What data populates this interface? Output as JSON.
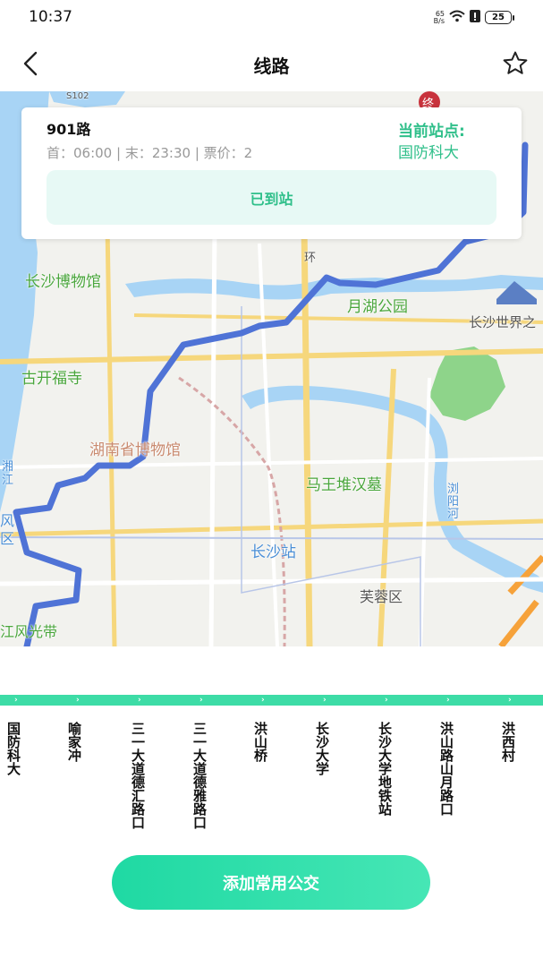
{
  "status_bar": {
    "time": "10:37",
    "net_speed_value": "65",
    "net_speed_unit": "B/s",
    "battery": "25"
  },
  "nav": {
    "title": "线路"
  },
  "map": {
    "labels": {
      "museum": "长沙博物馆",
      "yuehu_park": "月湖公园",
      "world": "长沙世界之",
      "gukai_temple": "古开福寺",
      "hunan_museum": "湖南省博物馆",
      "mawangdui": "马王堆汉墓",
      "changsha_station": "长沙站",
      "furong": "芙蓉区",
      "liuyang_river": "浏阳河",
      "xiangjiang": "湘江",
      "feng_qu": "风区",
      "jiang_fengguang": "江风光带",
      "huan": "环",
      "road_s102": "S102",
      "terminal": "终"
    }
  },
  "route_card": {
    "route_name": "901路",
    "times": "首：06:00 | 末：23:30 | 票价：2",
    "current_label": "当前站点:",
    "current_station": "国防科大",
    "arrived_label": "已到站"
  },
  "stations": [
    {
      "name": "国防科大"
    },
    {
      "name": "喻家冲"
    },
    {
      "name": "三一大道德汇路口"
    },
    {
      "name": "三一大道德雅路口"
    },
    {
      "name": "洪山桥"
    },
    {
      "name": "长沙大学"
    },
    {
      "name": "长沙大学地铁站"
    },
    {
      "name": "洪山路山月路口"
    },
    {
      "name": "洪西村"
    }
  ],
  "actions": {
    "add_favorite_bus": "添加常用公交"
  },
  "colors": {
    "accent": "#2fbf8a",
    "strip": "#3ddca6",
    "route_line": "#4f73d6",
    "water": "#a8d4f5"
  }
}
